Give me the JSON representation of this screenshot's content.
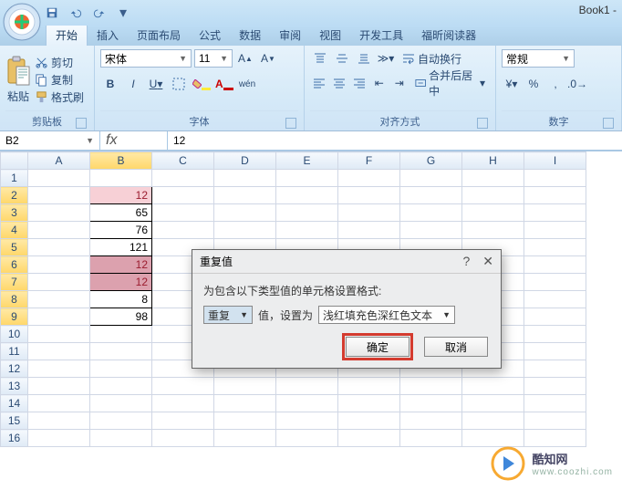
{
  "title": "Book1 -",
  "tabs": [
    "开始",
    "插入",
    "页面布局",
    "公式",
    "数据",
    "审阅",
    "视图",
    "开发工具",
    "福昕阅读器"
  ],
  "active_tab": 0,
  "clipboard": {
    "label": "剪贴板",
    "paste": "粘贴",
    "cut": "剪切",
    "copy": "复制",
    "format": "格式刷"
  },
  "font": {
    "label": "字体",
    "name": "宋体",
    "size": "11",
    "bold": "B",
    "italic": "I",
    "underline": "U"
  },
  "align": {
    "label": "对齐方式",
    "wrap": "自动换行",
    "merge": "合并后居中"
  },
  "number": {
    "label": "数字",
    "format": "常规"
  },
  "namebox": "B2",
  "fx": "fx",
  "fvalue": "12",
  "columns": [
    "A",
    "B",
    "C",
    "D",
    "E",
    "F",
    "G",
    "H",
    "I"
  ],
  "rows_count": 16,
  "selected_col": 1,
  "grid_data": {
    "2": {
      "B": "12",
      "dup": true
    },
    "3": {
      "B": "65"
    },
    "4": {
      "B": "76"
    },
    "5": {
      "B": "121"
    },
    "6": {
      "B": "12",
      "dup2": true
    },
    "7": {
      "B": "12",
      "dup2": true
    },
    "8": {
      "B": "8"
    },
    "9": {
      "B": "98"
    }
  },
  "block_range": {
    "col": "B",
    "r1": 2,
    "r2": 9
  },
  "dialog": {
    "title": "重复值",
    "help": "?",
    "close": "✕",
    "prompt": "为包含以下类型值的单元格设置格式:",
    "type": "重复",
    "mid": "值，设置为",
    "format_opt": "浅红填充色深红色文本",
    "ok": "确定",
    "cancel": "取消"
  },
  "watermark": {
    "name": "酷知网",
    "url": "www.coozhi.com"
  }
}
